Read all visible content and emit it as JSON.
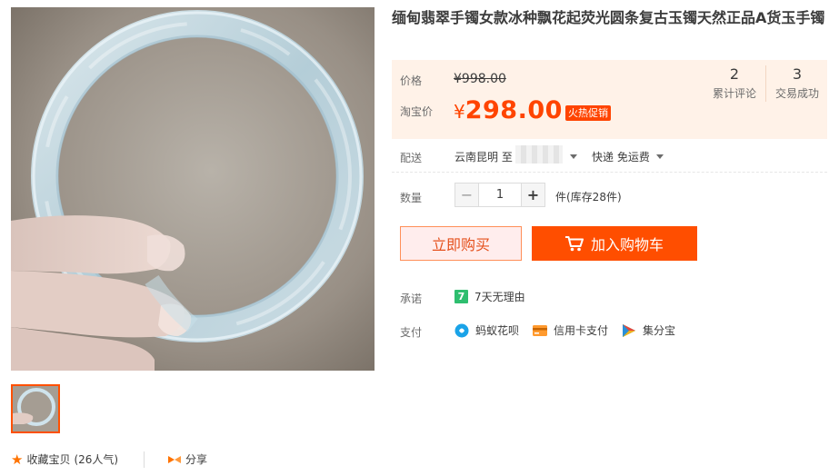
{
  "product": {
    "title": "缅甸翡翠手镯女款冰种飘花起荧光圆条复古玉镯天然正品A货玉手镯"
  },
  "price": {
    "original_label": "价格",
    "original_price": "¥998.00",
    "promo_label": "淘宝价",
    "currency": "¥",
    "promo_price": "298.00",
    "promo_tag": "火热促销"
  },
  "stats": {
    "reviews_count": "2",
    "reviews_label": "累计评论",
    "sales_count": "3",
    "sales_label": "交易成功"
  },
  "delivery": {
    "label": "配送",
    "from": "云南昆明 至",
    "shipping": "快递 免运费"
  },
  "quantity": {
    "label": "数量",
    "minus": "−",
    "value": "1",
    "plus": "+",
    "stock_note": "件(库存28件)"
  },
  "actions": {
    "buy_now": "立即购买",
    "add_to_cart": "加入购物车"
  },
  "promise": {
    "label": "承诺",
    "badge": "7",
    "text": "7天无理由"
  },
  "payment": {
    "label": "支付",
    "methods": [
      {
        "name": "蚂蚁花呗",
        "icon": "huabei-icon",
        "color": "#1aa3e8"
      },
      {
        "name": "信用卡支付",
        "icon": "credit-card-icon",
        "color": "#ff9a2e"
      },
      {
        "name": "集分宝",
        "icon": "jifenbao-icon",
        "color": "#38b24a"
      }
    ]
  },
  "bottom": {
    "favorite_label": "收藏宝贝",
    "favorite_count": "(26人气)",
    "share_label": "分享"
  },
  "colors": {
    "accent": "#ff4400",
    "price_panel_bg": "#fff2e8",
    "cart_button": "#ff4e00",
    "buy_button_bg": "#ffeded"
  }
}
